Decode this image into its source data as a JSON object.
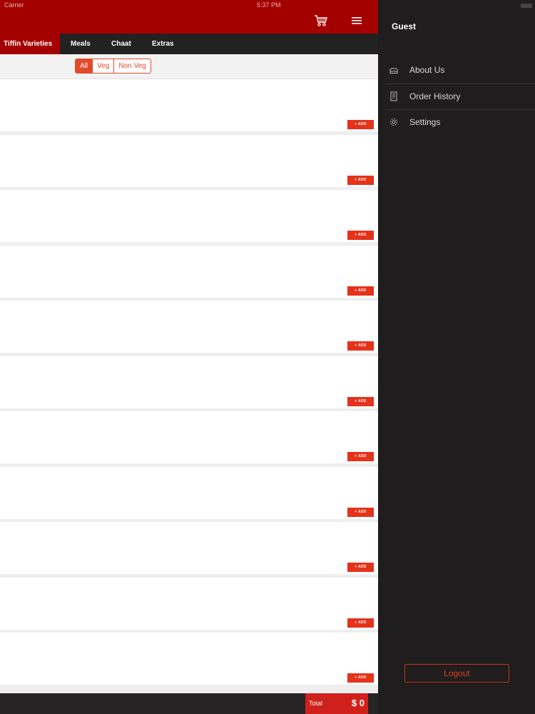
{
  "status": {
    "carrier": "Carrier",
    "time": "5:37 PM"
  },
  "header": {
    "cart_icon": "cart-icon",
    "menu_icon": "hamburger-menu-icon"
  },
  "tabs": [
    {
      "label": "Tiffin Varieties",
      "active": true
    },
    {
      "label": "Meals",
      "active": false
    },
    {
      "label": "Chaat",
      "active": false
    },
    {
      "label": "Extras",
      "active": false
    }
  ],
  "filter": {
    "options": [
      {
        "label": "All",
        "active": true
      },
      {
        "label": "Veg",
        "active": false
      },
      {
        "label": "Non Veg",
        "active": false
      }
    ]
  },
  "items": {
    "add_label": "+ ADD",
    "count": 11
  },
  "footer": {
    "total_label": "Total",
    "total_value": "$ 0"
  },
  "side_menu": {
    "user": "Guest",
    "items": [
      {
        "label": "About Us",
        "icon": "chef-hat-icon"
      },
      {
        "label": "Order History",
        "icon": "receipt-icon"
      },
      {
        "label": "Settings",
        "icon": "gear-icon"
      }
    ],
    "logout_label": "Logout"
  },
  "colors": {
    "brand": "#a40000",
    "accent": "#e5321b",
    "dark": "#1f1d1d"
  }
}
